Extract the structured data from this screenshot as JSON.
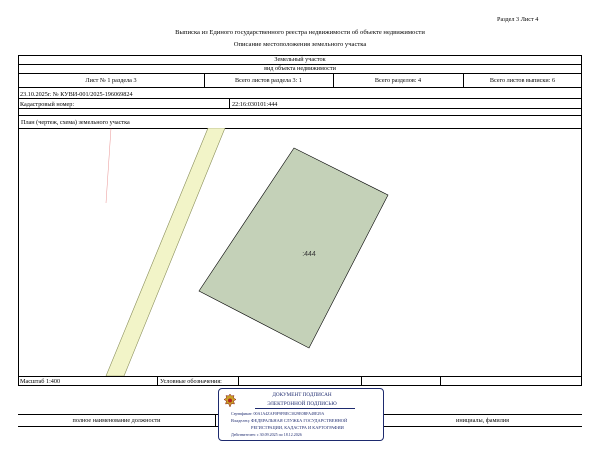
{
  "header": {
    "section_page": "Раздел 3   Лист 4",
    "title": "Выписка из Единого государственного реестра недвижимости об объекте недвижимости",
    "subtitle": "Описание местоположения земельного участка"
  },
  "object": {
    "type": "Земельный участок",
    "type_caption": "вид объекта недвижимости"
  },
  "info_row": {
    "sheet": "Лист № 1 раздела 3",
    "section_sheets": "Всего листов раздела 3: 1",
    "sections": "Всего разделов: 4",
    "total_sheets": "Всего листов выписки: 6"
  },
  "doc": {
    "number": "23.10.2025г. № КУВИ-001/2025-196069824",
    "cadastral_label": "Кадастровый номер:",
    "cadastral_number": "22:16:030101:444"
  },
  "plan": {
    "title": "План (чертеж, схема) земельного участка",
    "parcel_label": ":444",
    "parcel_color": "#c4d1b8",
    "strip_color": "#f2f4c8",
    "line_color": "#d94a4a"
  },
  "legend_row": {
    "scale": "Масштаб 1:400",
    "symbols": "Условные обозначения:"
  },
  "signature_row": {
    "position_label": "полное наименование должности",
    "name_label": "инициалы, фамилия"
  },
  "stamp": {
    "line1": "ДОКУМЕНТ ПОДПИСАН",
    "line2": "ЭЛЕКТРОННОЙ ПОДПИСЬЮ",
    "certificate": "Сертификат: 00A1A4ZAF0F9FBEC3029E0BFA48E29A",
    "owner_line1": "Владелец: ФЕДЕРАЛЬНАЯ СЛУЖБА ГОСУДАРСТВЕННОЙ",
    "owner_line2": "РЕГИСТРАЦИИ, КАДАСТРА И КАРТОГРАФИИ",
    "valid": "Действителен: с 30.09.2025 по 18.12.2026"
  }
}
